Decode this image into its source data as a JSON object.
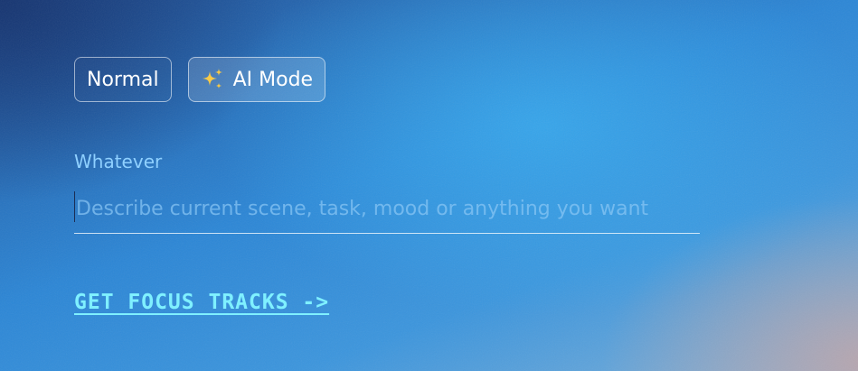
{
  "modes": {
    "normal_label": "Normal",
    "ai_label": "AI Mode",
    "ai_icon": "sparkles-icon",
    "active": "ai"
  },
  "prompt": {
    "label": "Whatever",
    "value": "",
    "placeholder": "Describe current scene, task, mood or anything you want"
  },
  "cta": {
    "label": "GET FOCUS TRACKS ->"
  },
  "colors": {
    "accent_cyan": "#7ff0ff",
    "label_blue": "#8fd0ff",
    "sparkle_yellow": "#f7c948"
  }
}
